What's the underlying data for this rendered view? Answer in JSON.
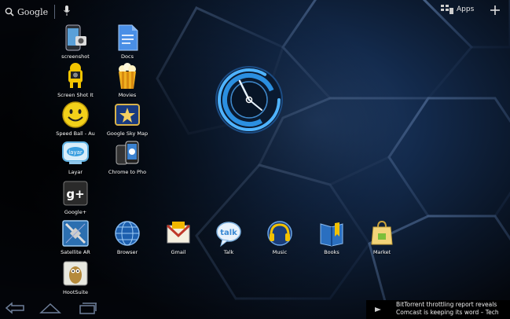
{
  "search": {
    "label": "Google"
  },
  "topbar": {
    "apps_label": "Apps"
  },
  "apps": [
    {
      "label": "screenshot",
      "icon": "screenshot-icon"
    },
    {
      "label": "Docs",
      "icon": "docs-icon"
    },
    {
      "label": "Screen Shot It",
      "icon": "screen-shot-it-icon"
    },
    {
      "label": "Movies",
      "icon": "movies-icon"
    },
    {
      "label": "Speed Ball - Au",
      "icon": "speed-ball-icon"
    },
    {
      "label": "Google Sky Map",
      "icon": "sky-map-icon"
    },
    {
      "label": "Layar",
      "icon": "layar-icon"
    },
    {
      "label": "Chrome to Pho",
      "icon": "chrome-to-phone-icon"
    },
    {
      "label": "Google+",
      "icon": "google-plus-icon"
    },
    {
      "label": "Satellite AR",
      "icon": "satellite-ar-icon"
    },
    {
      "label": "HootSuite",
      "icon": "hootsuite-icon"
    }
  ],
  "dock": [
    {
      "label": "Browser",
      "icon": "browser-icon"
    },
    {
      "label": "Gmail",
      "icon": "gmail-icon"
    },
    {
      "label": "Talk",
      "icon": "talk-icon"
    },
    {
      "label": "Music",
      "icon": "music-icon"
    },
    {
      "label": "Books",
      "icon": "books-icon"
    },
    {
      "label": "Market",
      "icon": "market-icon"
    }
  ],
  "notification": {
    "line1": "BitTorrent throttling report reveals",
    "line2": "Comcast is keeping its word – Tech"
  },
  "colors": {
    "clock_ring": "#4fb3ff",
    "accent": "#2b8fe0"
  }
}
